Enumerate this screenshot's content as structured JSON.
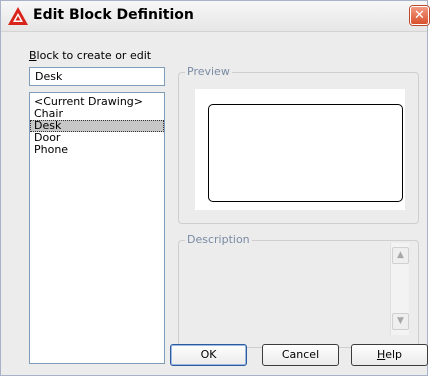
{
  "window": {
    "title": "Edit Block Definition",
    "close_glyph": "✕"
  },
  "block": {
    "label_accel": "B",
    "label_rest": "lock to create or edit",
    "value": "Desk",
    "list": [
      {
        "label": "<Current Drawing>",
        "selected": false
      },
      {
        "label": "Chair",
        "selected": false
      },
      {
        "label": "Desk",
        "selected": true
      },
      {
        "label": "Door",
        "selected": false
      },
      {
        "label": "Phone",
        "selected": false
      }
    ]
  },
  "preview": {
    "legend": "Preview"
  },
  "description": {
    "legend": "Description",
    "value": "",
    "scroll_up_glyph": "▲",
    "scroll_down_glyph": "▼"
  },
  "buttons": {
    "ok": "OK",
    "cancel": "Cancel",
    "help_accel": "H",
    "help_rest": "elp"
  },
  "colors": {
    "accent_red": "#d9512c",
    "legend_text": "#7a8ba3",
    "selection": "#c7c7c7"
  },
  "icons": {
    "app": "autocad-logo-icon",
    "close": "close-icon",
    "scroll_up": "scroll-up-arrow-icon",
    "scroll_down": "scroll-down-arrow-icon"
  }
}
